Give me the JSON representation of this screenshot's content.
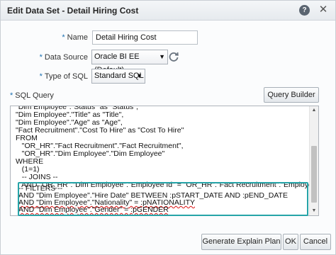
{
  "dialog": {
    "title": "Edit Data Set - Detail Hiring Cost",
    "help_icon": "help-icon",
    "close_icon": "close-icon"
  },
  "form": {
    "name_label": "Name",
    "name_value": "Detail Hiring Cost",
    "data_source_label": "Data Source",
    "data_source_value": "Oracle BI EE (Default)",
    "type_of_sql_label": "Type of SQL",
    "type_of_sql_value": "Standard SQL",
    "sql_query_label": "SQL Query",
    "required_marker": "*"
  },
  "query_builder_label": "Query Builder",
  "sql_lines": [
    "\"Dim Employee\".\"Status\" as \"Status\",",
    "\"Dim Employee\".\"Title\" as \"Title\",",
    "\"Dim Employee\".\"Age\" as \"Age\",",
    "\"Fact Recruitment\".\"Cost To Hire\" as \"Cost To Hire\"",
    "FROM",
    "   \"OR_HR\".\"Fact Recruitment\".\"Fact Recruitment\",",
    "   \"OR_HR\".\"Dim Employee\".\"Dim Employee\"",
    "WHERE",
    "   (1=1)",
    "   -- JOINS --",
    "   AND \"OR_HR\".\"Dim Employee\".\"Employee Id\" = \"OR_HR\".\"Fact Recruitment\".\"Employee Id\"",
    "",
    "-- FILTERS --",
    "AND \"Dim Employee\".\"Hire Date\" BETWEEN :pSTART_DATE AND :pEND_DATE",
    "AND \"Dim Employee\".\"Nationality\" = :pNATIONALITY",
    "AND \"Dim Employee\".\"Gender\" = :pGENDER"
  ],
  "buttons": {
    "explain_plan": "Generate Explain Plan",
    "ok": "OK",
    "cancel": "Cancel"
  },
  "colors": {
    "highlight": "#26a4a8",
    "required": "#1a6fb0"
  }
}
